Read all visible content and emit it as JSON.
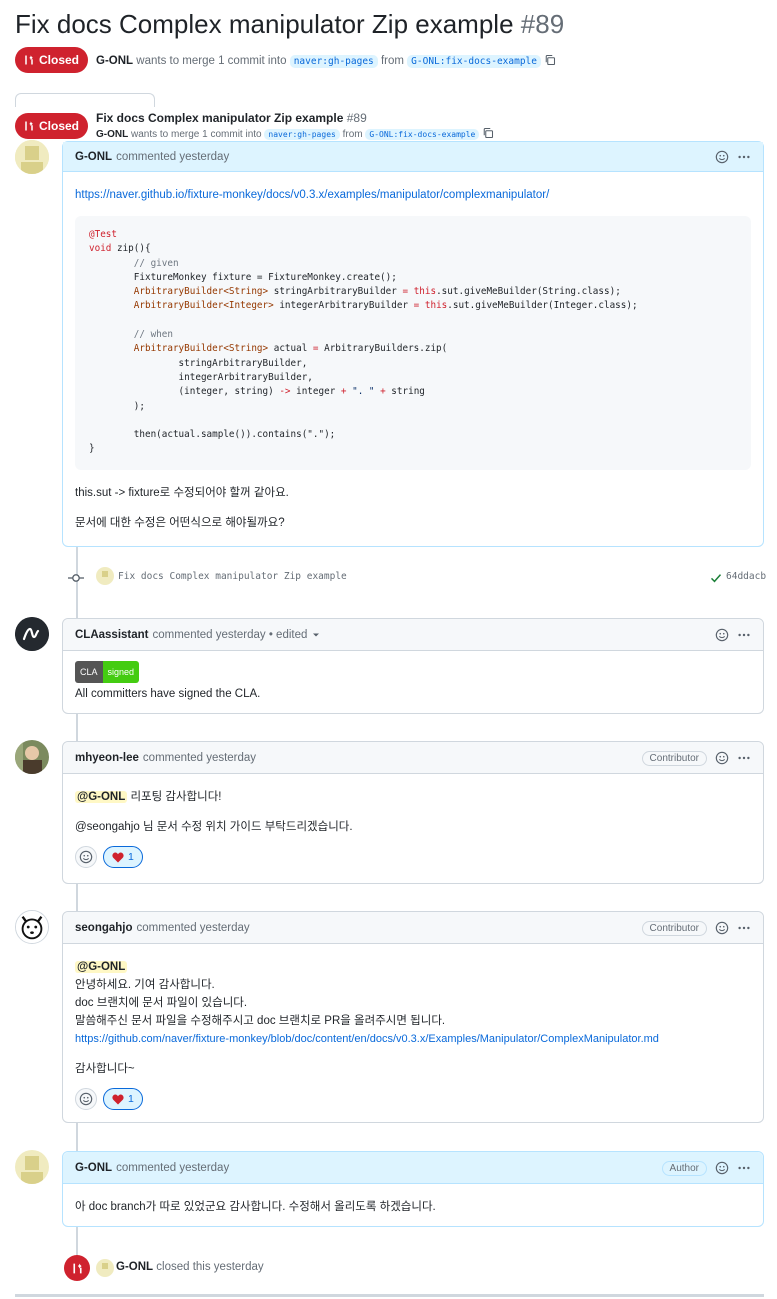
{
  "pr": {
    "title": "Fix docs Complex manipulator Zip example",
    "number": "#89",
    "state": "Closed",
    "author": "G-ONL",
    "merge_text": "wants to merge 1 commit into",
    "base_branch": "naver:gh-pages",
    "from_text": "from",
    "head_branch": "G-ONL:fix-docs-example"
  },
  "comments": [
    {
      "author": "G-ONL",
      "meta": "commented yesterday",
      "link": "https://naver.github.io/fixture-monkey/docs/v0.3.x/examples/manipulator/complexmanipulator/",
      "code": {
        "l1": "@Test",
        "l2a": "void",
        "l2b": " zip(){",
        "l3": "        // given",
        "l4": "        FixtureMonkey fixture = FixtureMonkey.create();",
        "l5a": "ArbitraryBuilder<String>",
        "l5b": " stringArbitraryBuilder ",
        "l5c": "=",
        "l5d": "this",
        "l5e": ".sut.giveMeBuilder(String.class);",
        "l6a": "ArbitraryBuilder<Integer>",
        "l6b": " integerArbitraryBuilder ",
        "l6c": "=",
        "l6d": "this",
        "l6e": ".sut.giveMeBuilder(Integer.class);",
        "l7": "        // when",
        "l8a": "ArbitraryBuilder<String>",
        "l8b": " actual ",
        "l8c": "=",
        "l8d": " ArbitraryBuilders.zip(",
        "l9": "                stringArbitraryBuilder,",
        "l10": "                integerArbitraryBuilder,",
        "l11a": "                (integer, string) ",
        "l11b": "->",
        "l11c": " integer ",
        "l11d": "+",
        "l11e": " \". \" ",
        "l11f": "+",
        "l11g": " string",
        "l12": "        );",
        "l13": "        then(actual.sample()).contains(\".\");",
        "l14": "}"
      },
      "p1": "this.sut -> fixture로 수정되어야 할꺼 같아요.",
      "p2": "문서에 대한 수정은 어떤식으로 해야될까요?"
    },
    {
      "author": "CLAassistant",
      "meta": "commented yesterday • edited",
      "badge_left": "CLA",
      "badge_right": "signed",
      "text": "All committers have signed the CLA."
    },
    {
      "author": "mhyeon-lee",
      "meta": "commented yesterday",
      "role": "Contributor",
      "mention": "@G-ONL",
      "p1": " 리포팅 감사합니다!",
      "p2": "@seongahjo 님 문서 수정 위치 가이드 부탁드리겠습니다.",
      "reaction_count": "1"
    },
    {
      "author": "seongahjo",
      "meta": "commented yesterday",
      "role": "Contributor",
      "mention": "@G-ONL",
      "l1": "안녕하세요. 기여 감사합니다.",
      "l2": "doc 브랜치에 문서 파일이 있습니다.",
      "l3": "말씀해주신 문서 파일을 수정해주시고 doc 브랜치로 PR을 올려주시면 됩니다.",
      "link": "https://github.com/naver/fixture-monkey/blob/doc/content/en/docs/v0.3.x/Examples/Manipulator/ComplexManipulator.md",
      "l4": "감사합니다~",
      "reaction_count": "1"
    },
    {
      "author": "G-ONL",
      "meta": "commented yesterday",
      "role": "Author",
      "text": "아 doc branch가 따로 있었군요 감사합니다. 수정해서 올리도록 하겠습니다."
    }
  ],
  "commit": {
    "message": "Fix docs Complex manipulator Zip example",
    "sha": "64ddacb"
  },
  "closed_event": {
    "actor": "G-ONL",
    "text": "closed this yesterday"
  }
}
